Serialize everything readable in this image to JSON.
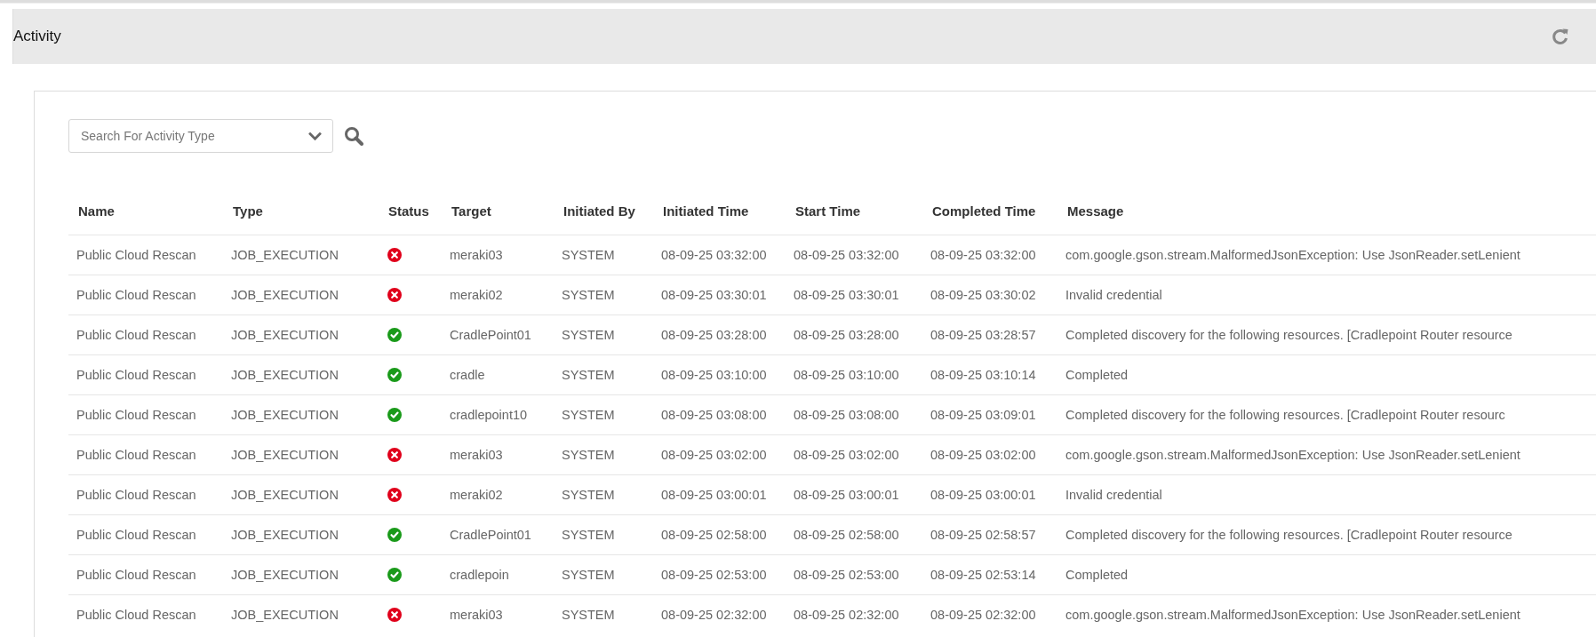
{
  "header": {
    "title": "Activity"
  },
  "search": {
    "placeholder": "Search For Activity Type"
  },
  "table": {
    "columns": [
      "Name",
      "Type",
      "Status",
      "Target",
      "Initiated By",
      "Initiated Time",
      "Start Time",
      "Completed Time",
      "Message"
    ],
    "rows": [
      {
        "name": "Public Cloud Rescan",
        "type": "JOB_EXECUTION",
        "failed": true,
        "target": "meraki03",
        "initiated_by": "SYSTEM",
        "initiated_time": "08-09-25 03:32:00",
        "start_time": "08-09-25 03:32:00",
        "completed_time": "08-09-25 03:32:00",
        "message": "com.google.gson.stream.MalformedJsonException: Use JsonReader.setLenient"
      },
      {
        "name": "Public Cloud Rescan",
        "type": "JOB_EXECUTION",
        "failed": true,
        "target": "meraki02",
        "initiated_by": "SYSTEM",
        "initiated_time": "08-09-25 03:30:01",
        "start_time": "08-09-25 03:30:01",
        "completed_time": "08-09-25 03:30:02",
        "message": "Invalid credential"
      },
      {
        "name": "Public Cloud Rescan",
        "type": "JOB_EXECUTION",
        "failed": false,
        "target": "CradlePoint01",
        "initiated_by": "SYSTEM",
        "initiated_time": "08-09-25 03:28:00",
        "start_time": "08-09-25 03:28:00",
        "completed_time": "08-09-25 03:28:57",
        "message": "Completed discovery for the following resources. [Cradlepoint Router resource"
      },
      {
        "name": "Public Cloud Rescan",
        "type": "JOB_EXECUTION",
        "failed": false,
        "target": "cradle",
        "initiated_by": "SYSTEM",
        "initiated_time": "08-09-25 03:10:00",
        "start_time": "08-09-25 03:10:00",
        "completed_time": "08-09-25 03:10:14",
        "message": "Completed"
      },
      {
        "name": "Public Cloud Rescan",
        "type": "JOB_EXECUTION",
        "failed": false,
        "target": "cradlepoint10",
        "initiated_by": "SYSTEM",
        "initiated_time": "08-09-25 03:08:00",
        "start_time": "08-09-25 03:08:00",
        "completed_time": "08-09-25 03:09:01",
        "message": "Completed discovery for the following resources. [Cradlepoint Router resourc"
      },
      {
        "name": "Public Cloud Rescan",
        "type": "JOB_EXECUTION",
        "failed": true,
        "target": "meraki03",
        "initiated_by": "SYSTEM",
        "initiated_time": "08-09-25 03:02:00",
        "start_time": "08-09-25 03:02:00",
        "completed_time": "08-09-25 03:02:00",
        "message": "com.google.gson.stream.MalformedJsonException: Use JsonReader.setLenient"
      },
      {
        "name": "Public Cloud Rescan",
        "type": "JOB_EXECUTION",
        "failed": true,
        "target": "meraki02",
        "initiated_by": "SYSTEM",
        "initiated_time": "08-09-25 03:00:01",
        "start_time": "08-09-25 03:00:01",
        "completed_time": "08-09-25 03:00:01",
        "message": "Invalid credential"
      },
      {
        "name": "Public Cloud Rescan",
        "type": "JOB_EXECUTION",
        "failed": false,
        "target": "CradlePoint01",
        "initiated_by": "SYSTEM",
        "initiated_time": "08-09-25 02:58:00",
        "start_time": "08-09-25 02:58:00",
        "completed_time": "08-09-25 02:58:57",
        "message": "Completed discovery for the following resources. [Cradlepoint Router resource"
      },
      {
        "name": "Public Cloud Rescan",
        "type": "JOB_EXECUTION",
        "failed": false,
        "target": "cradlepoin",
        "initiated_by": "SYSTEM",
        "initiated_time": "08-09-25 02:53:00",
        "start_time": "08-09-25 02:53:00",
        "completed_time": "08-09-25 02:53:14",
        "message": "Completed"
      },
      {
        "name": "Public Cloud Rescan",
        "type": "JOB_EXECUTION",
        "failed": true,
        "target": "meraki03",
        "initiated_by": "SYSTEM",
        "initiated_time": "08-09-25 02:32:00",
        "start_time": "08-09-25 02:32:00",
        "completed_time": "08-09-25 02:32:00",
        "message": "com.google.gson.stream.MalformedJsonException: Use JsonReader.setLenient"
      }
    ]
  }
}
